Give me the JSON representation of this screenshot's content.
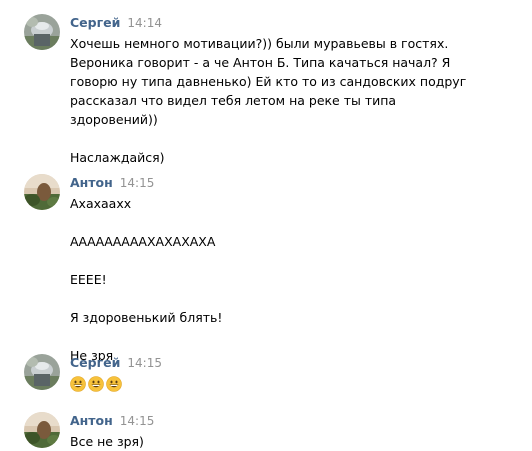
{
  "messages": [
    {
      "author": "Сергей",
      "time": "14:14",
      "lines": [
        "Хочешь немного мотивации?)) были муравьевы в гостях.",
        "Вероника говорит - а че Антон Б. Типа качаться начал? Я",
        "говорю ну типа давненько) Ей кто то из сандовских подруг",
        "рассказал что видел тебя летом на реке ты типа",
        "здоровений))"
      ],
      "line2": "Наслаждайся)"
    },
    {
      "author": "Антон",
      "time": "14:15",
      "texts": [
        "Ахахаахх",
        "АААААААААХАХАХАХА",
        "ЕЕЕЕ!",
        "Я здоровенький блять!",
        "Не зря"
      ]
    },
    {
      "author": "Сергей",
      "time": "14:15",
      "emoji": [
        "grinning-face",
        "grinning-face",
        "grinning-face"
      ]
    },
    {
      "author": "Антон",
      "time": "14:15",
      "text": "Все не зря)"
    }
  ],
  "colors": {
    "author": "#42648b",
    "time": "#939393",
    "text": "#000000",
    "emoji_face": "#f7c23b"
  }
}
